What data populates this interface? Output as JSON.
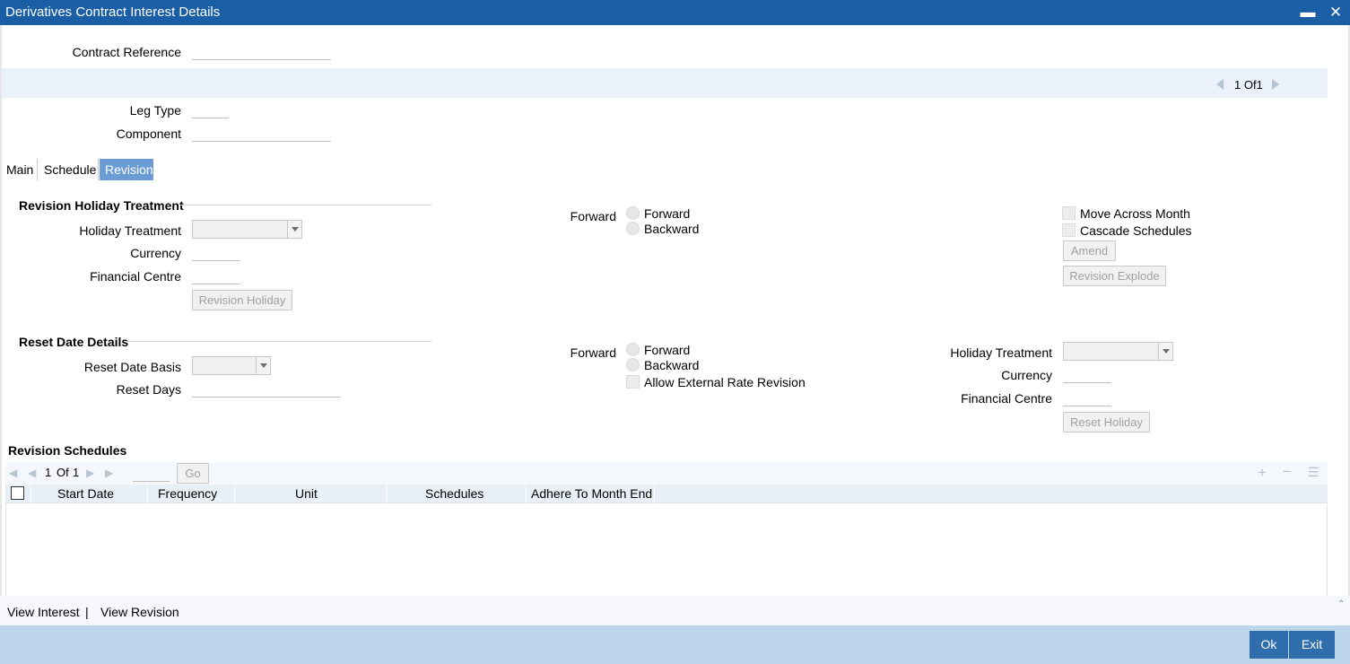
{
  "window": {
    "title": "Derivatives Contract Interest Details",
    "minimize_icon": "minimize-icon",
    "close_icon": "close-icon"
  },
  "header": {
    "contract_reference_label": "Contract Reference",
    "contract_reference_value": ""
  },
  "pager": {
    "current": "1",
    "of_label": "Of",
    "total": "1"
  },
  "leg": {
    "leg_type_label": "Leg Type",
    "leg_type_value": "",
    "component_label": "Component",
    "component_value": ""
  },
  "tabs": [
    {
      "label": "Main",
      "active": false
    },
    {
      "label": "Schedule",
      "active": false
    },
    {
      "label": "Revision",
      "active": true
    }
  ],
  "revision_holiday": {
    "section_title": "Revision Holiday Treatment",
    "holiday_treatment_label": "Holiday Treatment",
    "holiday_treatment_value": "",
    "currency_label": "Currency",
    "currency_value": "",
    "financial_centre_label": "Financial Centre",
    "financial_centre_value": "",
    "revision_holiday_button": "Revision Holiday",
    "forward_group_label": "Forward",
    "radio_forward": "Forward",
    "radio_backward": "Backward",
    "move_across_month": "Move Across Month",
    "cascade_schedules": "Cascade Schedules",
    "amend_button": "Amend",
    "revision_explode_button": "Revision Explode"
  },
  "reset_date": {
    "section_title": "Reset Date Details",
    "reset_date_basis_label": "Reset Date Basis",
    "reset_date_basis_value": "",
    "reset_days_label": "Reset Days",
    "reset_days_value": "",
    "forward_group_label": "Forward",
    "radio_forward": "Forward",
    "radio_backward": "Backward",
    "allow_external_rate_revision": "Allow External Rate Revision",
    "holiday_treatment_label": "Holiday Treatment",
    "holiday_treatment_value": "",
    "currency_label": "Currency",
    "currency_value": "",
    "financial_centre_label": "Financial Centre",
    "financial_centre_value": "",
    "reset_holiday_button": "Reset Holiday"
  },
  "revision_schedules": {
    "section_title": "Revision Schedules",
    "pager_current": "1",
    "pager_of": "Of",
    "pager_total": "1",
    "go_button": "Go",
    "columns": [
      "Start Date",
      "Frequency",
      "Unit",
      "Schedules",
      "Adhere To Month End"
    ],
    "rows": []
  },
  "footer_links": {
    "view_interest": "View Interest",
    "separator": "|",
    "view_revision": "View Revision"
  },
  "footer": {
    "ok_button": "Ok",
    "exit_button": "Exit"
  },
  "colors": {
    "titlebar": "#1a5ea6",
    "active_tab": "#6b9cd6",
    "footer_bar": "#bdd6ec",
    "primary_button": "#2f6dad"
  }
}
